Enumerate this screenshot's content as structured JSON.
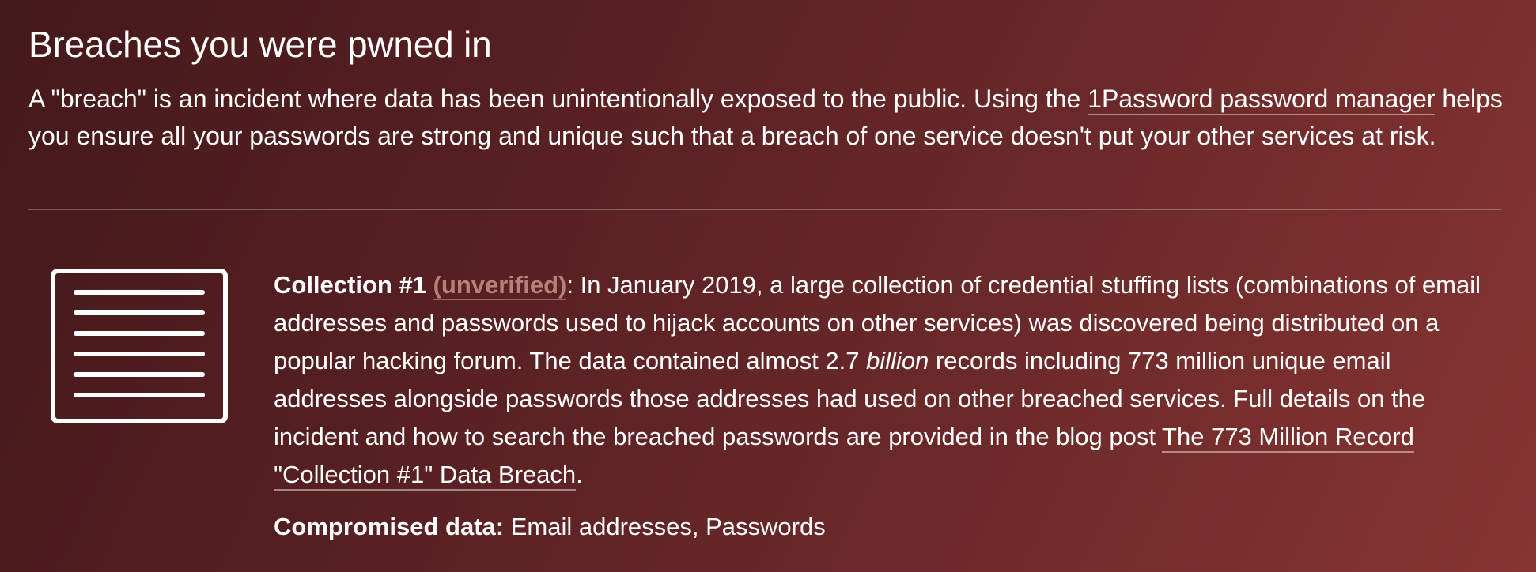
{
  "section": {
    "title": "Breaches you were pwned in",
    "intro": {
      "text_before": "A \"breach\" is an incident where data has been unintentionally exposed to the public. Using the ",
      "link_label": "1Password password manager",
      "text_after": " helps you ensure all your passwords are strong and unique such that a breach of one service doesn't put your other services at risk."
    }
  },
  "breach": {
    "icon": "document-lines-icon",
    "title": "Collection #1",
    "unverified_label": "(unverified)",
    "desc_part1": ": In January 2019, a large collection of credential stuffing lists (combinations of email addresses and passwords used to hijack accounts on other services) was discovered being distributed on a popular hacking forum. The data contained almost 2.7 ",
    "desc_emphasis": "billion",
    "desc_part2": " records including 773 million unique email addresses alongside passwords those addresses had used on other breached services. Full details on the incident and how to search the breached passwords are provided in the blog post ",
    "blog_link_label": "The 773 Million Record \"Collection #1\" Data Breach",
    "desc_end": ".",
    "compromised_label": "Compromised data:",
    "compromised_value": " Email addresses, Passwords"
  },
  "colors": {
    "background_start": "#44191c",
    "background_end": "#863532",
    "unverified": "#b97f79",
    "text": "#ffffff"
  }
}
